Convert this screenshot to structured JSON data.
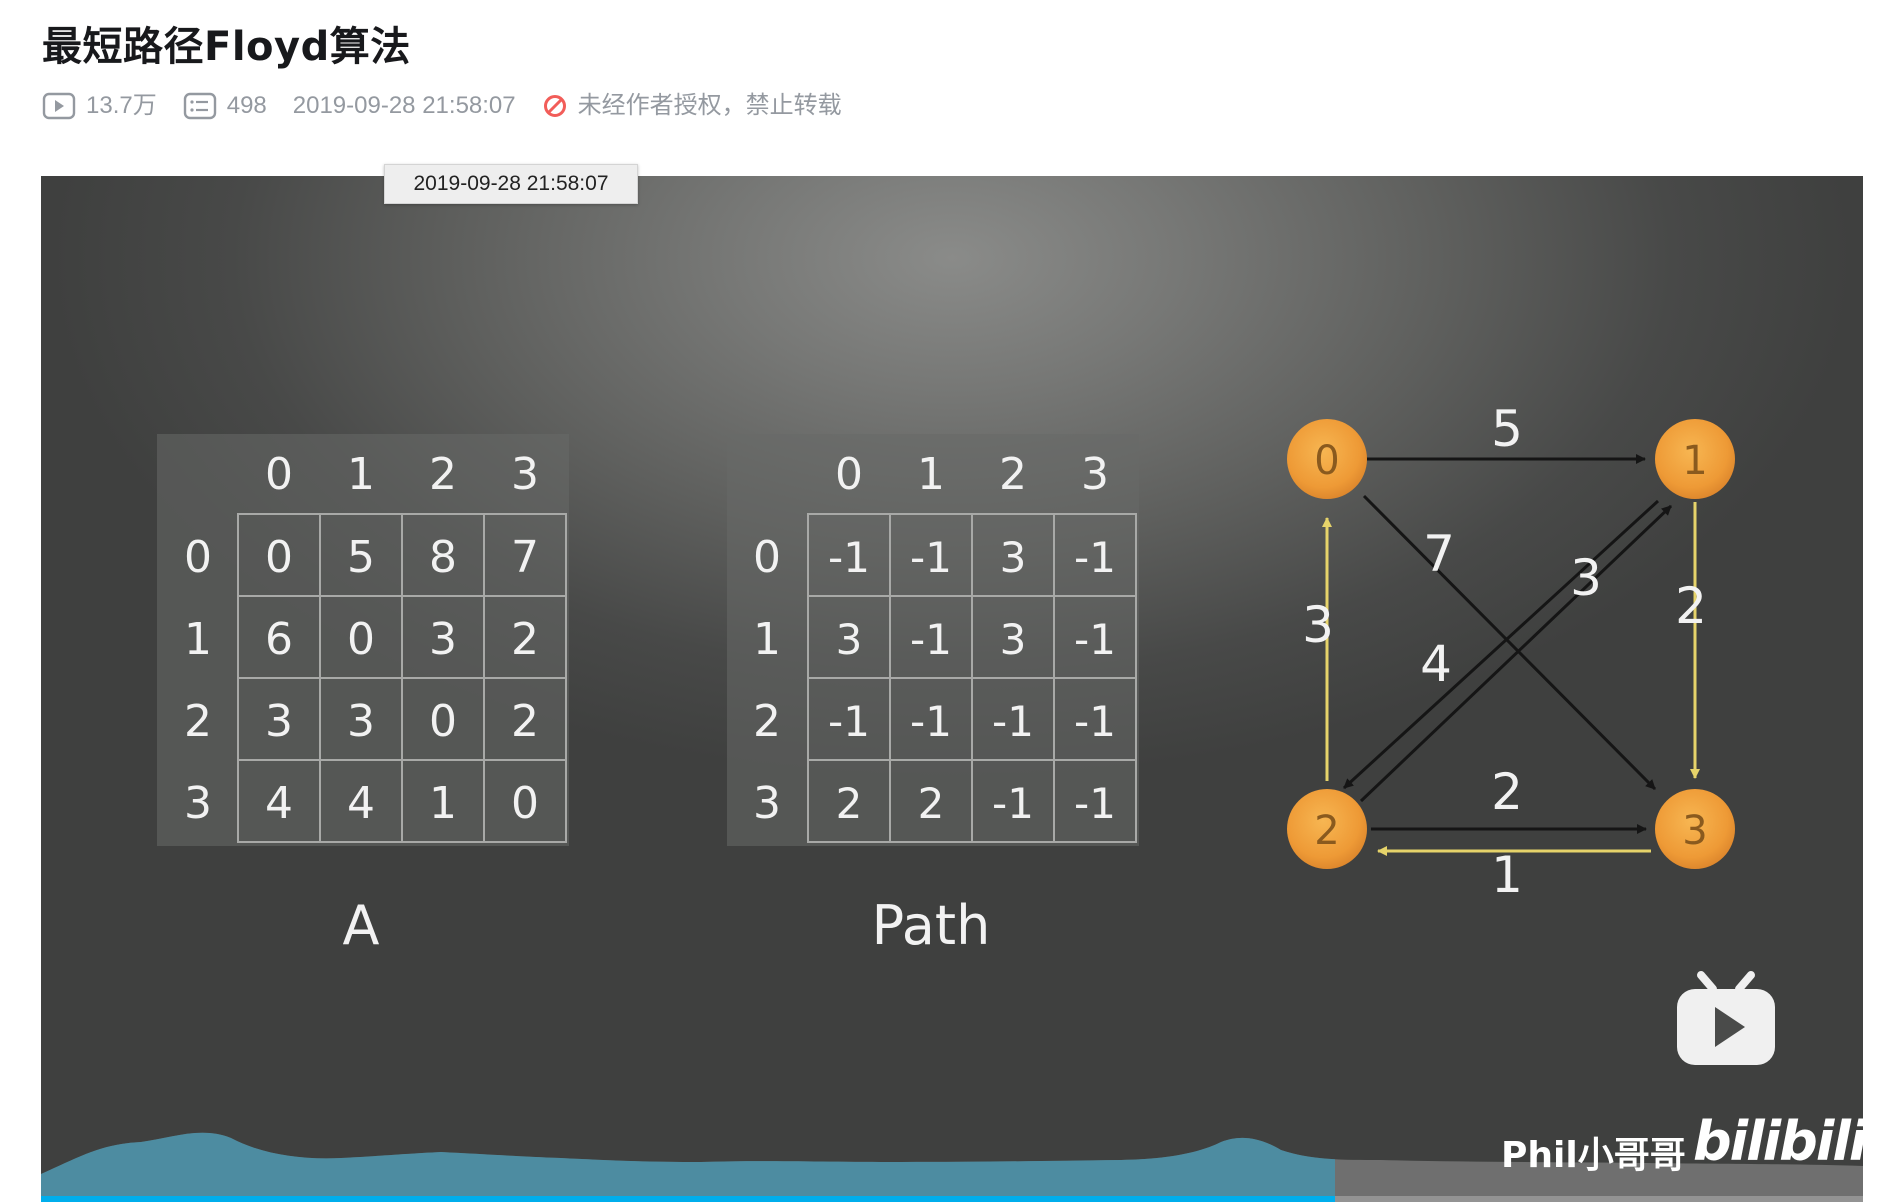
{
  "page_title": "最短路径Floyd算法",
  "meta": {
    "views": "13.7万",
    "danmaku": "498",
    "publish_time": "2019-09-28 21:58:07",
    "copyright_notice": "未经作者授权，禁止转载",
    "icons": [
      "play-count-icon",
      "danmaku-icon",
      "no-reprint-icon"
    ],
    "notice_color": "#f25d59"
  },
  "tooltip": "2019-09-28 21:58:07",
  "video": {
    "progress": 0.71,
    "progress_color": "#00aeec",
    "uploader_watermark": "Phil小哥哥",
    "brand_watermark": "bilibili",
    "frame": {
      "matrix_a": {
        "caption": "A",
        "col_headers": [
          "0",
          "1",
          "2",
          "3"
        ],
        "row_headers": [
          "0",
          "1",
          "2",
          "3"
        ],
        "rows": [
          [
            "0",
            "5",
            "8",
            "7"
          ],
          [
            "6",
            "0",
            "3",
            "2"
          ],
          [
            "3",
            "3",
            "0",
            "2"
          ],
          [
            "4",
            "4",
            "1",
            "0"
          ]
        ]
      },
      "matrix_path": {
        "caption": "Path",
        "col_headers": [
          "0",
          "1",
          "2",
          "3"
        ],
        "row_headers": [
          "0",
          "1",
          "2",
          "3"
        ],
        "rows": [
          [
            "-1",
            "-1",
            "3",
            "-1"
          ],
          [
            "3",
            "-1",
            "3",
            "-1"
          ],
          [
            "-1",
            "-1",
            "-1",
            "-1"
          ],
          [
            "2",
            "2",
            "-1",
            "-1"
          ]
        ]
      },
      "graph": {
        "nodes": [
          "0",
          "1",
          "2",
          "3"
        ],
        "edge_weights": {
          "e01": "5",
          "e03": "7",
          "e13": "2",
          "e12": "3",
          "e21": "4",
          "e20": "3",
          "e23": "2",
          "e32": "1"
        },
        "node_color": "#f0a13c",
        "highlight_edge_color": "#e6d36a"
      }
    }
  }
}
